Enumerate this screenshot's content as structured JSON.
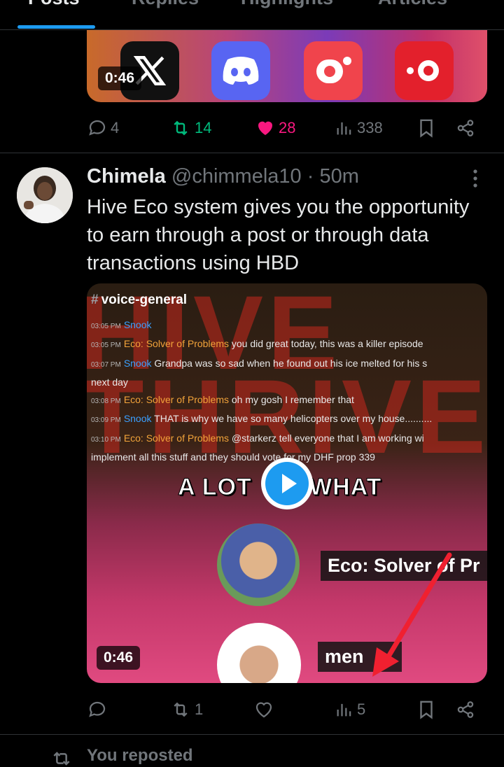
{
  "tabs": [
    "Posts",
    "Replies",
    "Highlights",
    "Articles"
  ],
  "tweet1": {
    "duration": "0:46",
    "apps": [
      "x-logo",
      "discord-logo",
      "screen-recorder-logo",
      "record-logo"
    ],
    "replies": "4",
    "reposts": "14",
    "likes": "28",
    "views": "338"
  },
  "tweet2": {
    "name": "Chimela",
    "handle": "@chimmela10",
    "dot": "·",
    "time": "50m",
    "text": "Hive Eco system gives you the opportunity to earn through a post or through data transactions using HBD",
    "media": {
      "hive_text": "HIVE THRIVE",
      "channel": "voice-general",
      "messages": [
        {
          "time": "03:05 PM",
          "user": "Snook",
          "text": "",
          "color": "blue"
        },
        {
          "time": "03:05 PM",
          "user": "Eco: Solver of Problems",
          "text": "you did great today, this was a killer episode",
          "color": "orange"
        },
        {
          "time": "03:07 PM",
          "user": "Snook",
          "text": "Grandpa was so sad when he found out his ice melted for his s",
          "color": "blue"
        },
        {
          "time": "",
          "user": "",
          "text": "next day",
          "color": ""
        },
        {
          "time": "03:08 PM",
          "user": "Eco: Solver of Problems",
          "text": "oh my gosh I remember that",
          "color": "orange"
        },
        {
          "time": "03:09 PM",
          "user": "Snook",
          "text": "THAT is why we have so many helicopters over my house..........",
          "color": "blue"
        },
        {
          "time": "03:10 PM",
          "user": "Eco: Solver of Problems",
          "text": "@starkerz tell everyone that I am working wi",
          "color": "orange"
        },
        {
          "time": "",
          "user": "",
          "text": "implement all this stuff and they should vote for my DHF prop 339",
          "color": ""
        }
      ],
      "caption_left": "A LOT",
      "caption_right": "WHAT",
      "speaker1_label": "Eco: Solver of Pr",
      "speaker2_label": "men",
      "duration": "0:46"
    },
    "replies": "",
    "reposts": "1",
    "likes": "",
    "views": "5"
  },
  "next": {
    "repost_label": "You reposted"
  },
  "colors": {
    "accent": "#1d9bf0",
    "like": "#f91880",
    "repost": "#00ba7c",
    "muted": "#71767b"
  }
}
